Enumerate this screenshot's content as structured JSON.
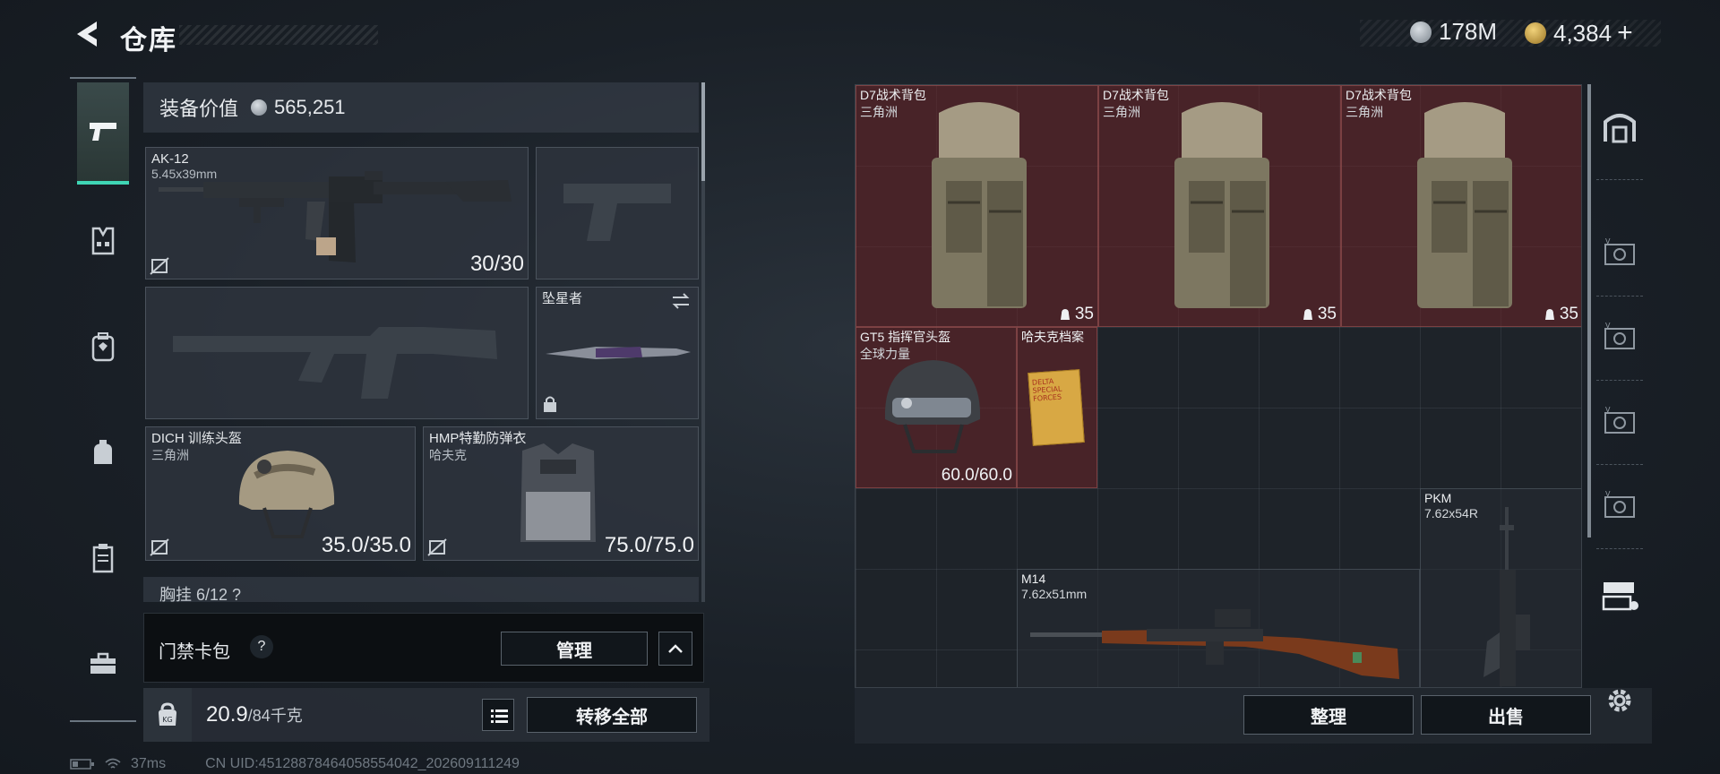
{
  "header": {
    "title": "仓库",
    "currency": [
      {
        "icon": "silver-coin-icon",
        "value": "178M"
      },
      {
        "icon": "gold-coin-icon",
        "value": "4,384",
        "suffix": "+"
      }
    ]
  },
  "nav": [
    "pistol-icon",
    "vest-icon",
    "backpack-icon",
    "bag-icon",
    "document-icon",
    "toolbox-icon"
  ],
  "loadout": {
    "value_label": "装备价值",
    "value": "565,251",
    "primary": {
      "name": "AK-12",
      "ammo": "5.45x39mm",
      "durability": "30/30"
    },
    "melee": {
      "name": "坠星者"
    },
    "helmet": {
      "name": "DICH 训练头盔",
      "brand": "三角洲",
      "durability": "35.0/35.0"
    },
    "armor": {
      "name": "HMP特勤防弹衣",
      "brand": "哈夫克",
      "durability": "75.0/75.0"
    },
    "chest_peek": "胸挂  6/12  ?"
  },
  "access_card": {
    "label": "门禁卡包",
    "help": "?",
    "manage": "管理"
  },
  "weight": {
    "current": "20.9",
    "max": "/84千克"
  },
  "transfer_all": "转移全部",
  "status": {
    "ping": "37ms",
    "uid": "CN UID:45128878464058554042_202609111249"
  },
  "stash": {
    "backpacks": [
      {
        "name": "D7战术背包",
        "brand": "三角洲",
        "capacity": "35"
      },
      {
        "name": "D7战术背包",
        "brand": "三角洲",
        "capacity": "35"
      },
      {
        "name": "D7战术背包",
        "brand": "三角洲",
        "capacity": "35"
      }
    ],
    "helmet": {
      "name": "GT5 指挥官头盔",
      "brand": "全球力量",
      "durability": "60.0/60.0"
    },
    "file": {
      "name": "哈夫克档案",
      "cover": "DELTA SPECIAL FORCES"
    },
    "m14": {
      "name": "M14",
      "ammo": "7.62x51mm"
    },
    "pkm": {
      "name": "PKM",
      "ammo": "7.62x54R"
    },
    "sort": "整理",
    "sell": "出售"
  },
  "colors": {
    "accent": "#3fd6b5",
    "item_red": "#6b2428"
  }
}
